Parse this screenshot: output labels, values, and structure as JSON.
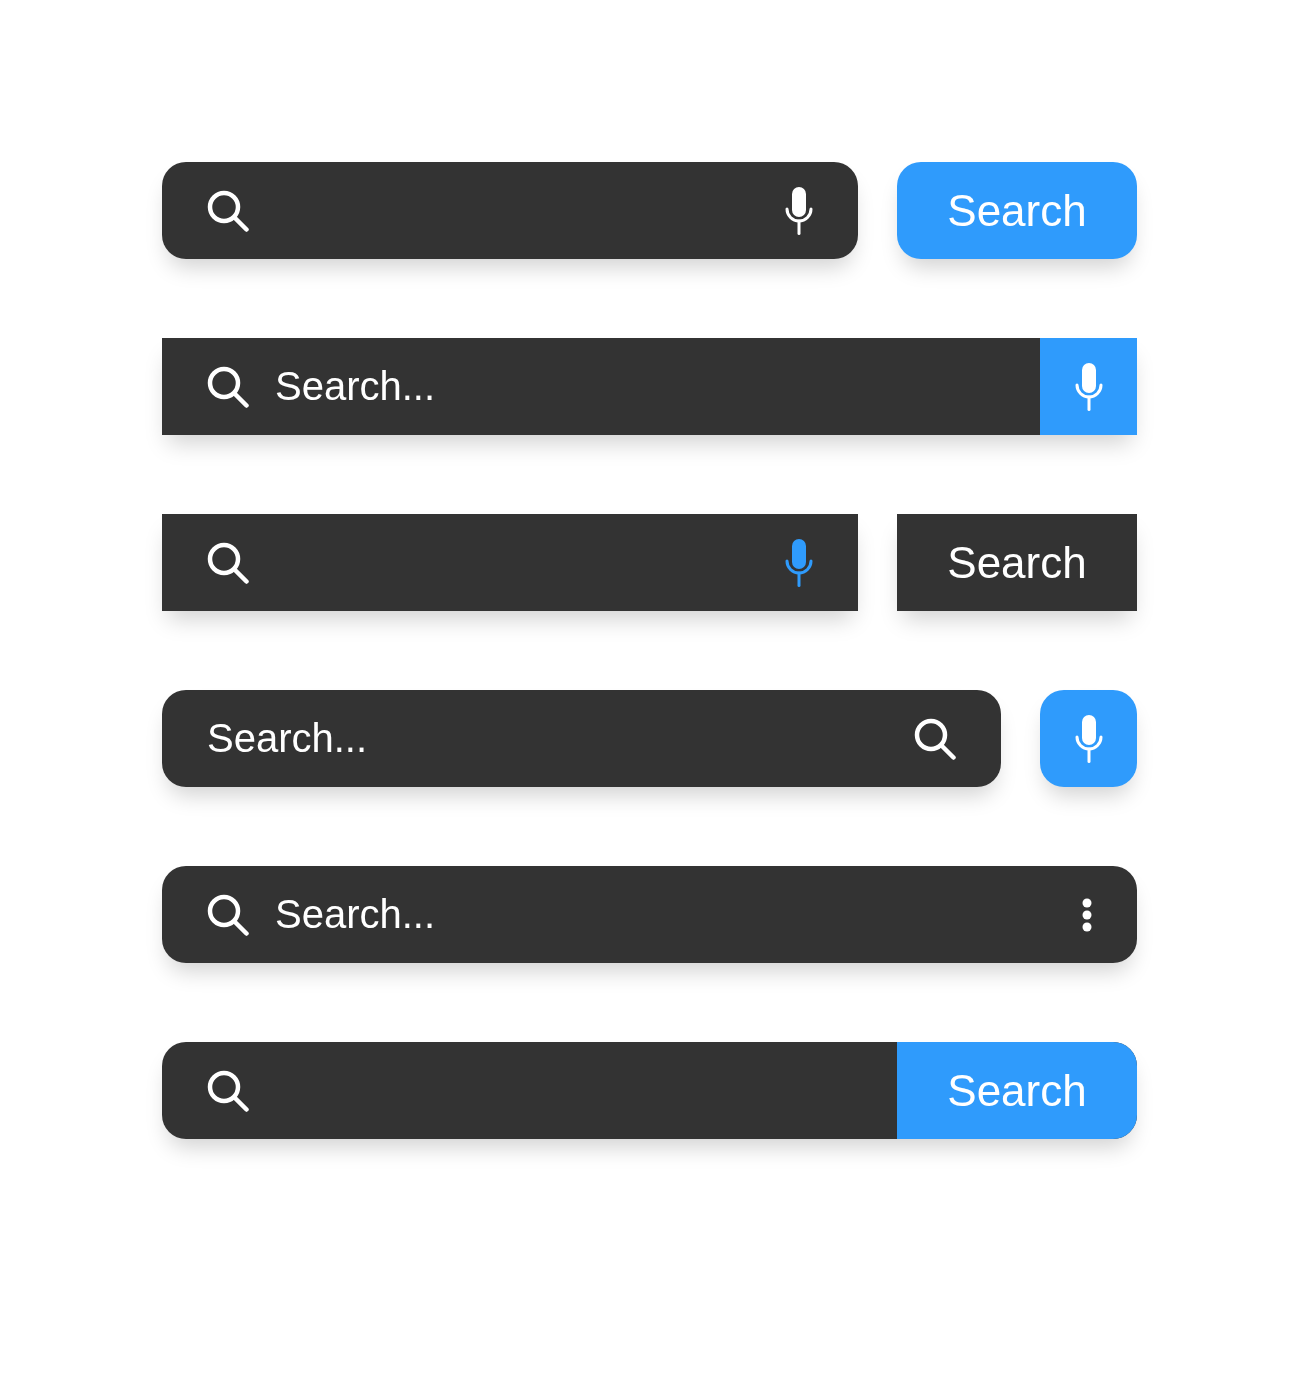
{
  "search_bars": [
    {
      "rounded": true,
      "joined": false,
      "field": {
        "parts": [
          {
            "kind": "search",
            "color": "#ffffff"
          },
          {
            "kind": "input"
          },
          {
            "kind": "mic",
            "color": "#ffffff"
          }
        ]
      },
      "button": {
        "kind": "label",
        "label": "Search",
        "color": "#2f9bfc"
      }
    },
    {
      "rounded": false,
      "joined": true,
      "field": {
        "parts": [
          {
            "kind": "search",
            "color": "#ffffff"
          },
          {
            "kind": "input",
            "placeholder": "Search..."
          }
        ]
      },
      "button": {
        "kind": "mic",
        "color": "#2f9bfc"
      }
    },
    {
      "rounded": false,
      "joined": false,
      "field": {
        "parts": [
          {
            "kind": "search",
            "color": "#ffffff"
          },
          {
            "kind": "input"
          },
          {
            "kind": "mic",
            "color": "#2f9bfc"
          }
        ]
      },
      "button": {
        "kind": "label",
        "label": "Search",
        "color": "#333333"
      }
    },
    {
      "rounded": true,
      "joined": false,
      "field": {
        "parts": [
          {
            "kind": "input",
            "placeholder": "Search..."
          },
          {
            "kind": "search",
            "color": "#ffffff"
          }
        ]
      },
      "button": {
        "kind": "mic",
        "color": "#2f9bfc"
      }
    },
    {
      "rounded": true,
      "field": {
        "parts": [
          {
            "kind": "search",
            "color": "#ffffff"
          },
          {
            "kind": "input",
            "placeholder": "Search..."
          },
          {
            "kind": "menu",
            "color": "#ffffff"
          }
        ]
      }
    },
    {
      "rounded": true,
      "joined": true,
      "field": {
        "parts": [
          {
            "kind": "search",
            "color": "#ffffff"
          },
          {
            "kind": "input"
          }
        ]
      },
      "button": {
        "kind": "label",
        "label": "Search",
        "color": "#2f9bfc"
      }
    }
  ]
}
